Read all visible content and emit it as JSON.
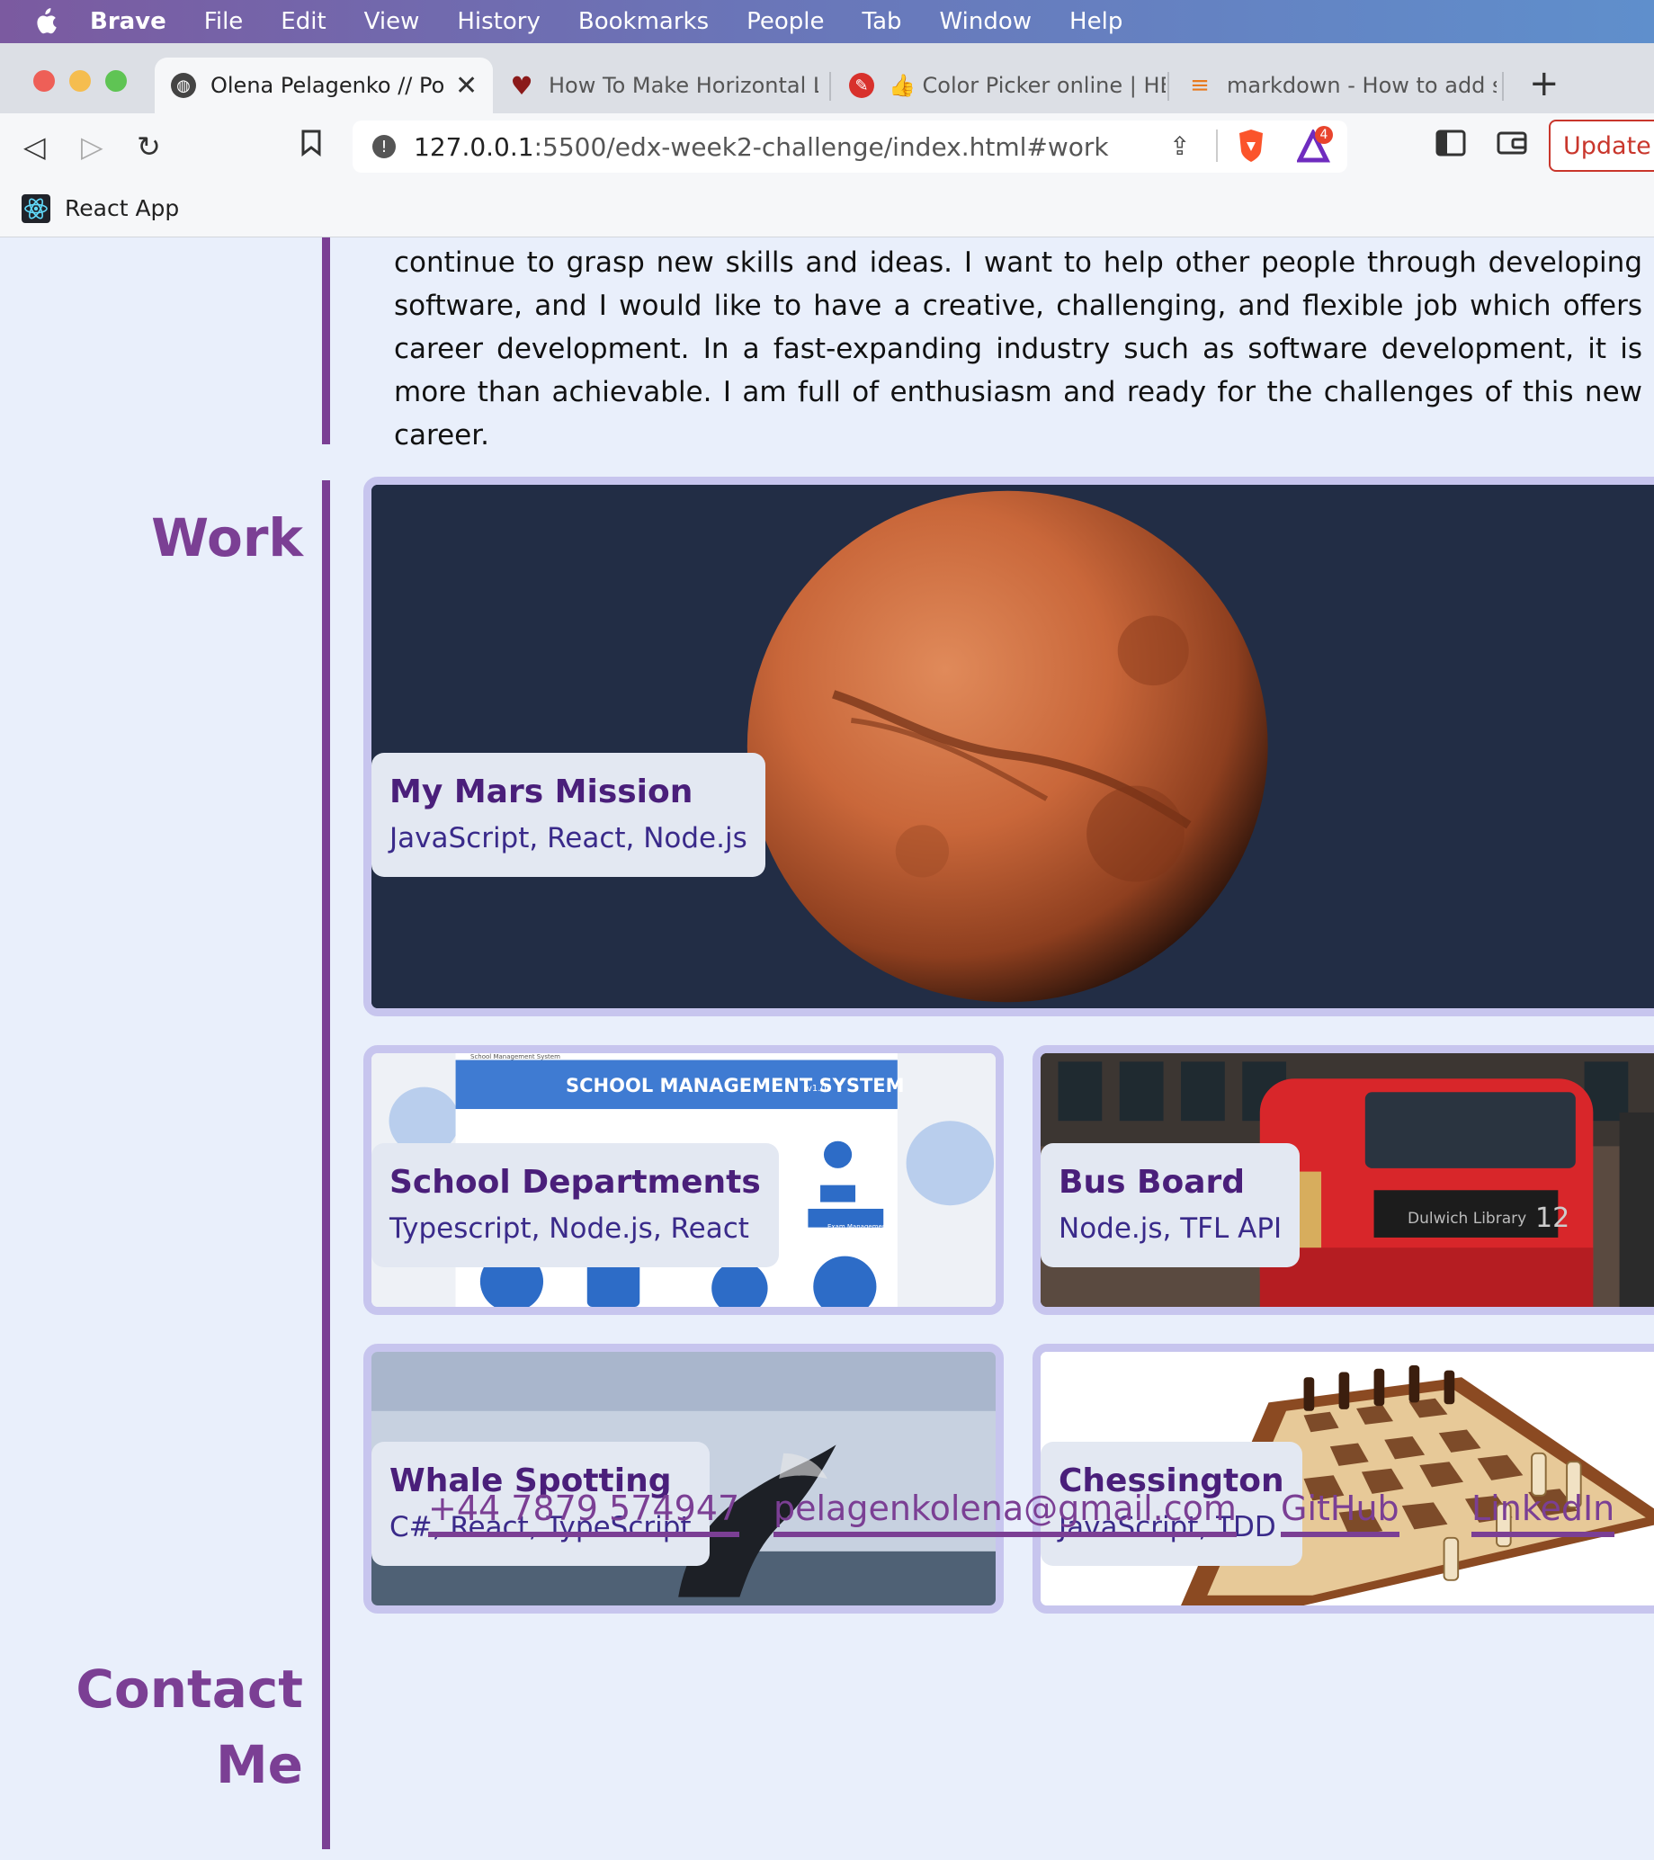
{
  "menubar": {
    "app": "Brave",
    "items": [
      "File",
      "Edit",
      "View",
      "History",
      "Bookmarks",
      "People",
      "Tab",
      "Window",
      "Help"
    ]
  },
  "tabs": [
    {
      "label": "Olena Pelagenko // Por",
      "active": true
    },
    {
      "label": "How To Make Horizontal Li",
      "active": false
    },
    {
      "label": "👍 Color Picker online | HE",
      "active": false
    },
    {
      "label": "markdown - How to add sc",
      "active": false
    }
  ],
  "toolbar": {
    "url_host": "127.0.0.1",
    "url_path": ":5500/edx-week2-challenge/index.html#work",
    "update_label": "Update",
    "shields_badge": "4"
  },
  "bookmarks": {
    "item": "React App"
  },
  "about": {
    "text": "continue to grasp new skills and ideas. I want to help other people through developing software, and I would like to have a creative, challenging, and flexible job which offers career development. In a fast-expanding industry such as software development, it is more than achievable. I am full of enthusiasm and ready for the challenges of this new career."
  },
  "work": {
    "title": "Work",
    "projects": [
      {
        "title": "My Mars Mission",
        "tech": "JavaScript, React, Node.js"
      },
      {
        "title": "School Departments",
        "tech": "Typescript, Node.js, React"
      },
      {
        "title": "Bus Board",
        "tech": "Node.js, TFL API"
      },
      {
        "title": "Whale Spotting",
        "tech": "C#, React, TypeScript"
      },
      {
        "title": "Chessington",
        "tech": "JavaScript, TDD"
      }
    ],
    "school_app_title": "SCHOOL MANAGEMENT SYSTEM",
    "school_app_version": "v1.0",
    "school_app_window": "School Management System",
    "school_app_labels": [
      "Exam Management"
    ],
    "bus_destination": "Dulwich Library",
    "bus_route": "12"
  },
  "contact": {
    "title_line1": "Contact",
    "title_line2": "Me",
    "phone": "+44 7879 574947",
    "email": "pelagenkolena@gmail.com",
    "github": "GitHub",
    "linkedin": "LinkedIn"
  },
  "colors": {
    "accent": "#7b3f94",
    "card_border": "#c7c5ee",
    "page_bg": "#e9effb",
    "caption_title": "#4a1f7a"
  }
}
